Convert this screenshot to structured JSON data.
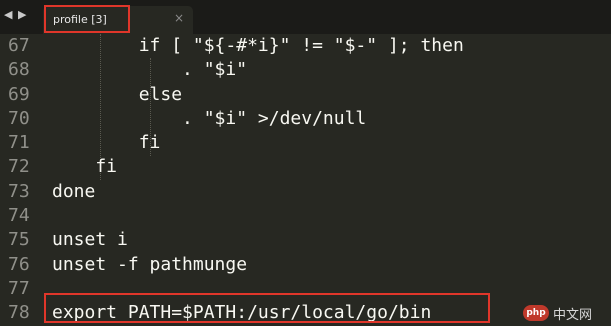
{
  "tab": {
    "label": "profile [3]",
    "close": "×"
  },
  "nav": {
    "back": "◀",
    "forward": "▶"
  },
  "lines": [
    {
      "num": "67",
      "text": "        if [ \"${-#*i}\" != \"$-\" ]; then"
    },
    {
      "num": "68",
      "text": "            . \"$i\""
    },
    {
      "num": "69",
      "text": "        else"
    },
    {
      "num": "70",
      "text": "            . \"$i\" >/dev/null"
    },
    {
      "num": "71",
      "text": "        fi"
    },
    {
      "num": "72",
      "text": "    fi"
    },
    {
      "num": "73",
      "text": "done"
    },
    {
      "num": "74",
      "text": ""
    },
    {
      "num": "75",
      "text": "unset i"
    },
    {
      "num": "76",
      "text": "unset -f pathmunge"
    },
    {
      "num": "77",
      "text": ""
    },
    {
      "num": "78",
      "text": "export PATH=$PATH:/usr/local/go/bin"
    }
  ],
  "watermark": {
    "logo": "php",
    "text": "中文网"
  }
}
